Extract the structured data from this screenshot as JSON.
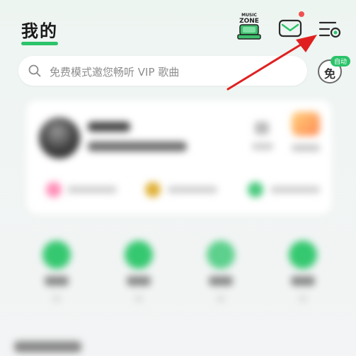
{
  "header": {
    "title": "我的",
    "music_zone_logo": {
      "line1": "MUSIC",
      "line2": "ZONE",
      "icon": "music-zone-icon"
    },
    "mail_icon": "mail-icon",
    "menu_icon": "menu-settings-icon"
  },
  "search": {
    "placeholder": "免费模式邀您畅听 VIP 歌曲",
    "icon": "search-icon"
  },
  "free_mode": {
    "glyph": "免",
    "badge": "自动"
  },
  "colors": {
    "accent": "#2bc36a",
    "notification": "#f05050",
    "annotation_arrow": "#e02020"
  }
}
